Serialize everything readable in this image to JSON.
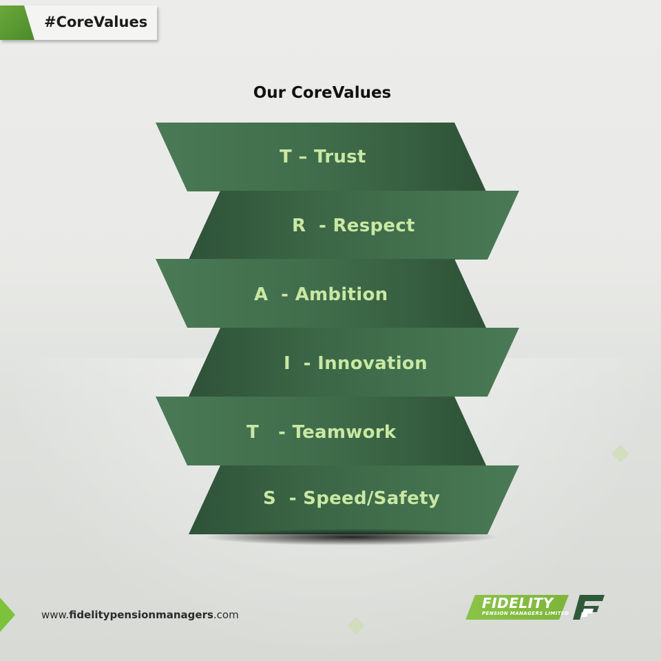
{
  "tag": {
    "text": "#CoreValues"
  },
  "heading": "Our CoreValues",
  "values": [
    {
      "label": "T – Trust"
    },
    {
      "label": "R  - Respect"
    },
    {
      "label": "A  - Ambition"
    },
    {
      "label": "I  - Innovation"
    },
    {
      "label": "T   - Teamwork"
    },
    {
      "label": "S  - Speed/Safety"
    }
  ],
  "footer": {
    "url_prefix": "www.",
    "url_domain": "fidelitypensionmanagers",
    "url_suffix": ".com"
  },
  "logo": {
    "name": "FIDELITY",
    "tagline": "PENSION MANAGERS LIMITED",
    "mark_icon": "fidelity-f-logo-icon"
  },
  "colors": {
    "band_green": "#3f6b4a",
    "label_green": "#c9e8a2",
    "accent_green": "#7cc23a"
  }
}
